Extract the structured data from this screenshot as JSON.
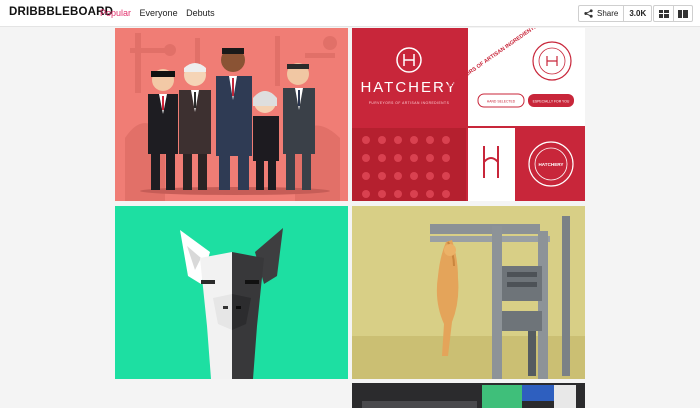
{
  "header": {
    "brand": "DRIBBBLEBOARD",
    "nav": [
      "Popular",
      "Everyone",
      "Debuts"
    ],
    "active_nav": "Popular",
    "share_label": "Share",
    "share_count": "3.0K"
  },
  "shots": {
    "hatchery": {
      "title": "HATCHERY",
      "tagline": "PURVEYORS OF ARTISAN INGREDIENTS",
      "subline": "PURVEYORS OF ARTISAN INGREDIENTS",
      "pill_left": "HAND SELECTED",
      "pill_right": "ESPECIALLY FOR YOU",
      "badge": "HATCHERY"
    }
  },
  "colors": {
    "accent": "#e2336e",
    "shot_portraits": "#f07d75",
    "shot_hatchery": "#c8263a",
    "shot_llama": "#1ddfa2",
    "shot_cat": "#d9cf84"
  }
}
